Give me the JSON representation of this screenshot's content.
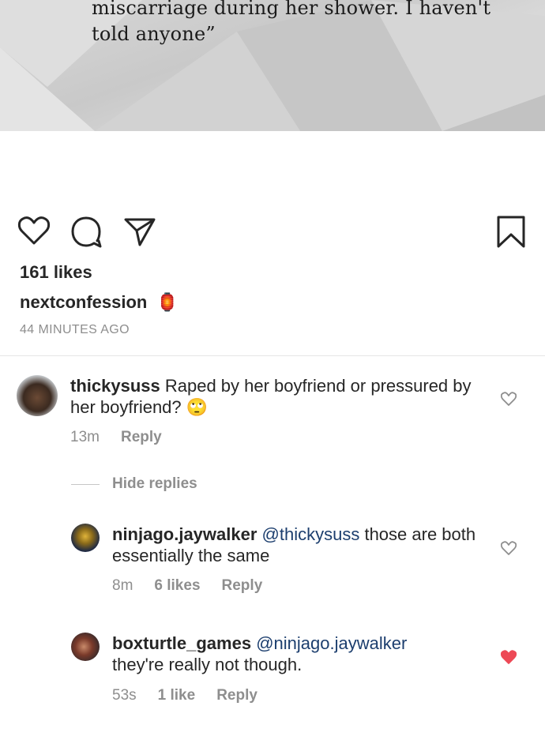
{
  "post": {
    "text_line1": "miscarriage during her shower. I haven't",
    "text_line2": "told anyone”"
  },
  "actions": {
    "like_icon": "heart-outline-icon",
    "comment_icon": "comment-bubble-icon",
    "share_icon": "paper-plane-icon",
    "save_icon": "bookmark-icon"
  },
  "likes": "161 likes",
  "caption": {
    "username": "nextconfession",
    "emoji": "🏮"
  },
  "timestamp": "44 MINUTES AGO",
  "comments": [
    {
      "username": "thickysuss",
      "text": " Raped by her boyfriend or pressured by her boyfriend? ",
      "emoji": "🙄",
      "time": "13m",
      "reply": "Reply"
    }
  ],
  "hide_replies": "Hide replies",
  "replies": [
    {
      "username": "ninjago.jaywalker",
      "mention": "@thickysuss",
      "text": " those are both essentially the same",
      "time": "8m",
      "likes": "6 likes",
      "reply": "Reply",
      "liked": false
    },
    {
      "username": "boxturtle_games",
      "mention": "@ninjago.jaywalker",
      "text": "they're really not though.",
      "time": "53s",
      "likes": "1 like",
      "reply": "Reply",
      "liked": true
    }
  ],
  "colors": {
    "liked_heart": "#ed4956",
    "mention": "#1c3e6e",
    "muted": "#8e8e8e"
  }
}
